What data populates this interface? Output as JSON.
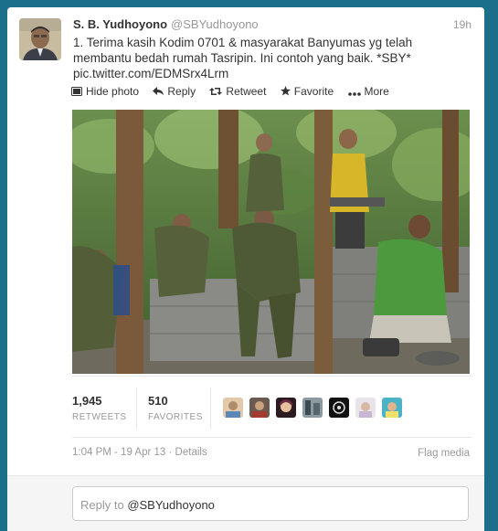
{
  "tweet": {
    "author_name": "S. B. Yudhoyono",
    "author_handle": "@SBYudhoyono",
    "time": "19h",
    "text_line1": "1. Terima kasih Kodim 0701 & masyarakat Banyumas yg telah",
    "text_line2": "membantu bedah rumah Tasripin. Ini contoh yang baik. *SBY*",
    "text_link": "pic.twitter.com/EDMSrx4Lrm"
  },
  "actions": {
    "hide_photo": "Hide photo",
    "reply": "Reply",
    "retweet": "Retweet",
    "favorite": "Favorite",
    "more": "More"
  },
  "stats": {
    "retweets_count": "1,945",
    "retweets_label": "RETWEETS",
    "favorites_count": "510",
    "favorites_label": "FAVORITES"
  },
  "meta": {
    "timestamp": "1:04 PM - 19 Apr 13",
    "separator": "·",
    "details": "Details",
    "flag_media": "Flag media"
  },
  "reply": {
    "prefix": "Reply to ",
    "handle": "@SBYudhoyono"
  },
  "colors": {
    "page_background": "#1b6f8a",
    "card": "#ffffff",
    "muted_text": "#999999",
    "body_text": "#333333"
  },
  "icons": {
    "hide_photo": "photo-icon",
    "reply": "reply-arrow-icon",
    "retweet": "retweet-icon",
    "favorite": "star-icon",
    "more": "ellipsis-icon"
  }
}
